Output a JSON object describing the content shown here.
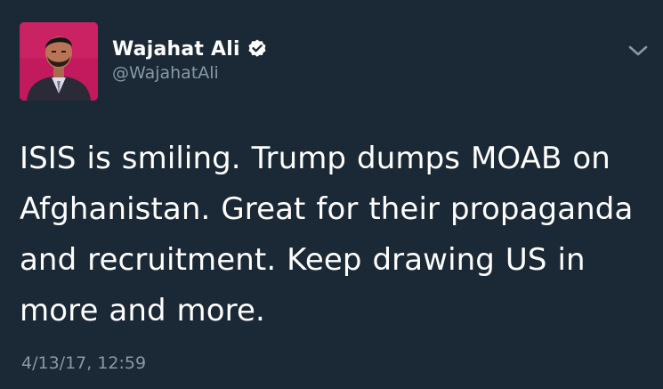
{
  "author": {
    "display_name": "Wajahat Ali",
    "handle": "@WajahatAli",
    "verified": true
  },
  "tweet": {
    "lines": [
      "ISIS is smiling. Trump dumps MOAB on",
      "Afghanistan. Great for their propaganda",
      "and recruitment. Keep drawing US in",
      "more and more."
    ],
    "timestamp": "4/13/17, 12:59"
  },
  "icons": {
    "verified": "verified-badge-icon",
    "menu": "chevron-down-icon"
  },
  "colors": {
    "background": "#1b2836",
    "primary_text": "#ffffff",
    "secondary_text": "#8899a6",
    "avatar_bg": "#c21a5c"
  }
}
